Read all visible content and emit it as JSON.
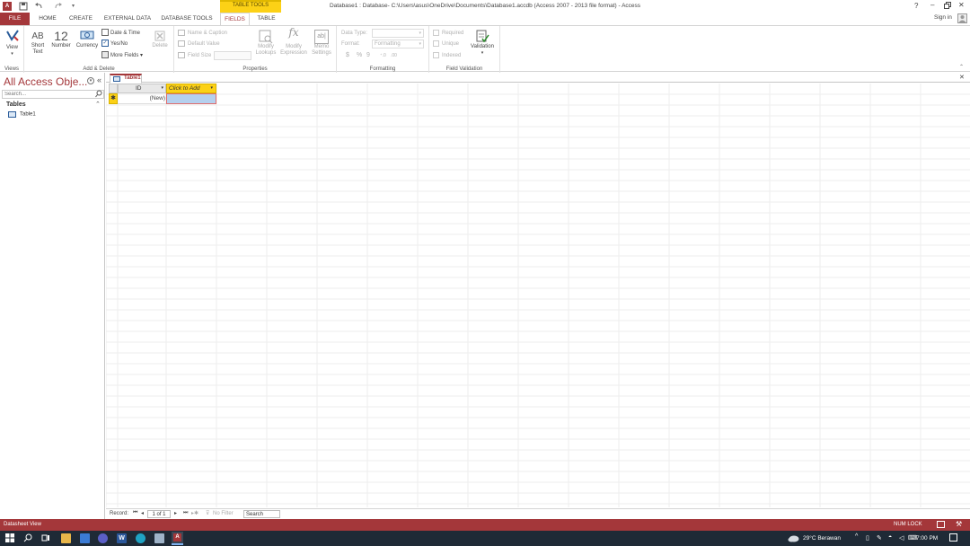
{
  "window": {
    "title": "Database1 : Database- C:\\Users\\asus\\OneDrive\\Documents\\Database1.accdb (Access 2007 - 2013 file format) - Access",
    "help": "?",
    "sign_in": "Sign in"
  },
  "context_tab": {
    "label": "TABLE TOOLS"
  },
  "ribbon_tabs": [
    {
      "label": "FILE"
    },
    {
      "label": "HOME"
    },
    {
      "label": "CREATE"
    },
    {
      "label": "EXTERNAL DATA"
    },
    {
      "label": "DATABASE TOOLS"
    },
    {
      "label": "FIELDS"
    },
    {
      "label": "TABLE"
    }
  ],
  "groups": {
    "views": {
      "label": "Views",
      "view_btn": "View"
    },
    "add_delete": {
      "label": "Add & Delete",
      "short_text": "Short Text",
      "short_text_glyph": "AB",
      "number": "Number",
      "number_glyph": "12",
      "currency": "Currency",
      "date_time": "Date & Time",
      "yes_no": "Yes/No",
      "more_fields": "More Fields",
      "delete": "Delete"
    },
    "properties": {
      "label": "Properties",
      "name_caption": "Name & Caption",
      "default_value": "Default Value",
      "field_size": "Field Size",
      "modify_lookups": "Modify Lookups",
      "modify_expression": "Modify Expression",
      "memo_settings": "Memo Settings"
    },
    "formatting": {
      "label": "Formatting",
      "data_type_label": "Data Type:",
      "format_label": "Format:",
      "format_value": "Formatting",
      "currency_sym": "$",
      "percent_sym": "%"
    },
    "field_validation": {
      "label": "Field Validation",
      "required": "Required",
      "unique": "Unique",
      "indexed": "Indexed",
      "validation": "Validation"
    }
  },
  "nav_pane": {
    "title": "All Access Obje...",
    "search_placeholder": "Search...",
    "section": "Tables",
    "items": [
      {
        "label": "Table1"
      }
    ]
  },
  "document": {
    "tab_label": "Table1",
    "columns": [
      {
        "label": "ID"
      },
      {
        "label": "Click to Add"
      }
    ],
    "new_row": "(New)"
  },
  "record_nav": {
    "label": "Record:",
    "position": "1 of 1",
    "filter": "No Filter",
    "search": "Search"
  },
  "status": {
    "view": "Datasheet View",
    "num_lock": "NUM LOCK"
  },
  "taskbar": {
    "weather": "29°C  Berawan",
    "time": "7:00 PM"
  },
  "colors": {
    "accent": "#a4373a",
    "context_tab": "#fcd116",
    "selected_cell": "#b5d0ee"
  }
}
